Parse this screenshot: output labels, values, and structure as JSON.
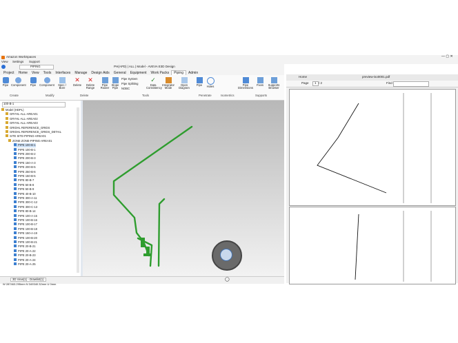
{
  "workspaces": {
    "title": "Amazon WorkSpaces",
    "menu": [
      "View",
      "Settings",
      "Support"
    ]
  },
  "app": {
    "title": "PH(APD) | ALL | Model - AVEVA E3D Design",
    "project_box": "PIPING"
  },
  "ribbon_tabs": [
    "Project",
    "Home",
    "View",
    "Tools",
    "Interfaces",
    "Manage",
    "Design Aids",
    "General",
    "Equipment",
    "Work Packs",
    "Piping",
    "Admin"
  ],
  "active_tab": "Piping",
  "ribbon_buttons": [
    "Pipe",
    "Component",
    "Pipe",
    "Component",
    "Spec / Bore",
    "Delete",
    "Delete Range",
    "Pipe Router",
    "Slope Pipe",
    "Pipe System",
    "Pipe Splitting",
    "NOBC",
    "Data Consistency",
    "Integrator Mode",
    "Open Diagram",
    "Pipe",
    "Holes",
    "Pipe Dimensions",
    "Fixes",
    "Supports Browser"
  ],
  "ribbon_groups": [
    "Create",
    "Modify",
    "Delete",
    "Tools",
    "Penetrate",
    "Isometrics",
    "Supports"
  ],
  "explorer": {
    "search": "100-B-1",
    "side_tab": "Model Explorer",
    "items": [
      "Model (HDPL)",
      "GRYHL-ALL-AREA01",
      "GRYHL-ALL-AREA02",
      "GRYHL-ALL-AREA03",
      "GRIDHL REFERENCE_GRIDS",
      "GRIDHL REFERENCE_GRIDS_DETAIL",
      "SITE SITE-PIPING-AREA01",
      "ZONE ZONE-PIPING-AREA01",
      "PIPE 100-B-1",
      "PIPE 100-B-1",
      "PIPE 200-B-2",
      "PIPE 200-B-3",
      "PIPE 150-A-3",
      "PIPE 200-B-5",
      "PIPE 250-B-6",
      "PIPE 150-B-5",
      "PIPE 80-B-7",
      "PIPE 50-B-8",
      "PIPE 50-B-9",
      "PIPE 40-B-10",
      "PIPE 300-A-11",
      "PIPE 300-C-12",
      "PIPE 300-C-13",
      "PIPE 80-B-14",
      "PIPE 100-A-15",
      "PIPE 100-B-16",
      "PIPE 100-B-17",
      "PIPE 100-B-18",
      "PIPE 150-A-19",
      "PIPE 100-B-20",
      "PIPE 100-B-21",
      "PIPE 20-B-21",
      "PIPE 20-A-22",
      "PIPE 20-B-23",
      "PIPE 20-A-24",
      "PIPE 20-A-25"
    ],
    "selected_index": 8
  },
  "status": {
    "view_tabs": "3D View(1) - Drawlist(1)",
    "coords": "W 287463.295mm N 349340.32mm U 0mm"
  },
  "pdf": {
    "tab_home": "Home",
    "tab_file": "preview-iso0001.pdf",
    "page": "1",
    "of": "/ 2",
    "find": "Find"
  },
  "colors": {
    "pipe": "#2e9d2e",
    "accent": "#1f5fbf"
  }
}
